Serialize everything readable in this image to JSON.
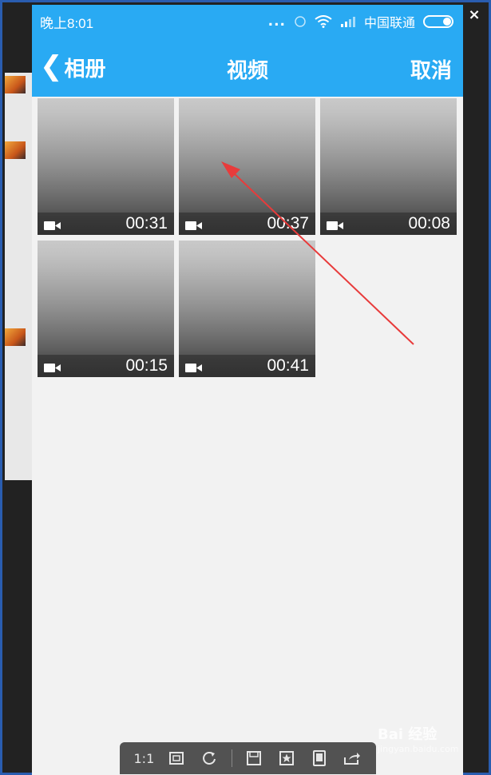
{
  "viewer": {
    "close_label": "×"
  },
  "status_bar": {
    "time": "晚上8:01",
    "dots": "...",
    "carrier": "中国联通"
  },
  "nav": {
    "back_label": "相册",
    "title": "视频",
    "cancel_label": "取消"
  },
  "videos": [
    {
      "duration": "00:31"
    },
    {
      "duration": "00:37"
    },
    {
      "duration": "00:08"
    },
    {
      "duration": "00:15"
    },
    {
      "duration": "00:41"
    }
  ],
  "toolbar": {
    "actual_size_label": "1:1"
  },
  "watermark": {
    "text": "Bai 经验",
    "sub": "jingyan.baidu.com"
  },
  "colors": {
    "header": "#29aaf3",
    "arrow": "#e83b3b",
    "frame_border": "#2a5db0"
  }
}
